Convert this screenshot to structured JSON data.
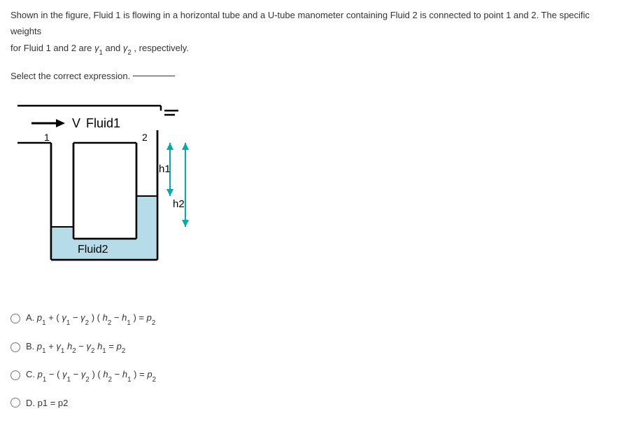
{
  "question": {
    "line1_pre": "Shown in the figure, Fluid 1 is flowing in a horizontal tube and a U-tube manometer containing Fluid 2 is connected to point 1 and 2. The specific weights",
    "line2_pre": "for Fluid 1 and 2 are ",
    "gamma": "γ",
    "sub1": "1",
    "line2_mid": " and ",
    "sub2": "2",
    "line2_end": ", respectively."
  },
  "select_text": "Select the correct expression.",
  "diagram": {
    "v_label": "V",
    "fluid1_label": "Fluid1",
    "fluid2_label": "Fluid2",
    "pt1": "1",
    "pt2": "2",
    "h1": "h1",
    "h2": "h2"
  },
  "options": {
    "A": {
      "prefix": "A. ",
      "p": "p",
      "s1": "1",
      "plus": "+ (",
      "g": "γ",
      "minus": "−",
      "s2": "2",
      "close": ") (",
      "h": "h",
      "eq": ") =",
      "pend": "p"
    },
    "B": {
      "prefix": "B. ",
      "p": "p",
      "s1": "1",
      "plus": "+",
      "g": "γ",
      "h": "h",
      "s2": "2",
      "minus": "−",
      "eq": "=",
      "pend": "p"
    },
    "C": {
      "prefix": "C. ",
      "p": "p",
      "s1": "1",
      "minus1": "− (",
      "g": "γ",
      "minus": "−",
      "s2": "2",
      "close": ") (",
      "h": "h",
      "eq": ") =",
      "pend": "p"
    },
    "D": {
      "prefix": "D. ",
      "text": "p1 = p2"
    }
  }
}
